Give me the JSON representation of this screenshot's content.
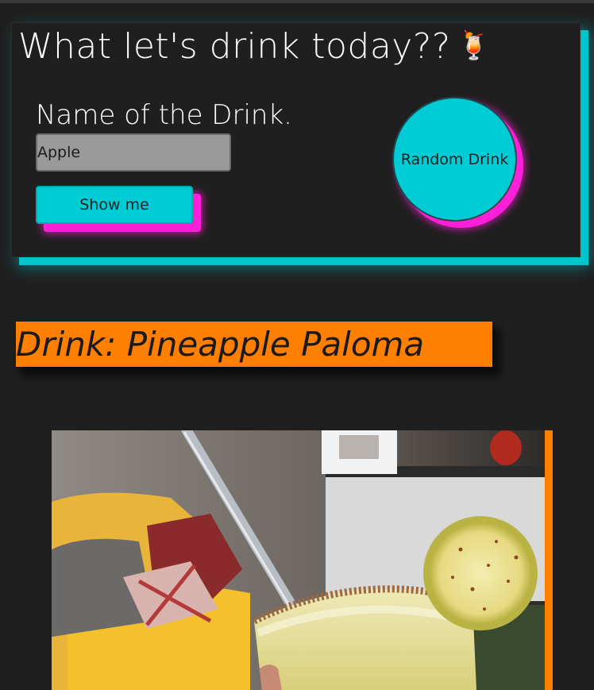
{
  "header": {
    "title": "What let's drink today??",
    "title_emoji": "🍹"
  },
  "form": {
    "name_label": "Name of the Drink.",
    "input_value": "Apple",
    "show_button_label": "Show me",
    "random_button_label": "Random Drink"
  },
  "result": {
    "drink_title": "Drink: Pineapple Paloma"
  },
  "colors": {
    "accent_cyan": "#00ccd6",
    "accent_magenta": "#ff1fd8",
    "accent_orange": "#ff7f00",
    "background": "#1f1f1f"
  }
}
